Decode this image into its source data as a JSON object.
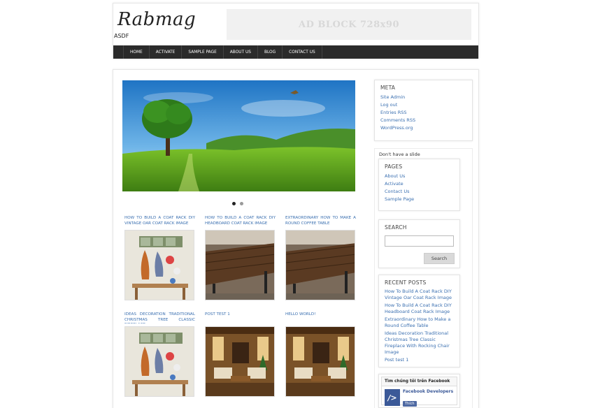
{
  "site": {
    "title": "Rabmag",
    "tagline": "ASDF",
    "ad_text": "AD BLOCK 728x90"
  },
  "nav": {
    "items": [
      "Home",
      "Activate",
      "Sample Page",
      "About Us",
      "Blog",
      "Contact Us"
    ]
  },
  "slider": {
    "dots": 2,
    "active_dot": 1
  },
  "posts": [
    {
      "title": "How to Build a Coat Rack DIY Vintage Oar Coat Rack Image",
      "image": "coat-rack-photo"
    },
    {
      "title": "How to Build a Coat Rack DIY Headboard Coat Rack Image",
      "image": "wooden-table-photo"
    },
    {
      "title": "Extraordinary How to Make a Round Coffee Table",
      "image": "wooden-table-photo"
    },
    {
      "title": "Ideas Decoration Traditional Christmas Tree Classic Fireplace",
      "image": "coat-rack-photo"
    },
    {
      "title": "Post test 1",
      "image": "living-room-photo"
    },
    {
      "title": "Hello world!",
      "image": "living-room-photo"
    }
  ],
  "sidebar": {
    "meta": {
      "title": "Meta",
      "links": [
        "Site Admin",
        "Log out",
        "Entries RSS",
        "Comments RSS",
        "WordPress.org"
      ]
    },
    "no_slide_note": "Don't have a slide",
    "pages": {
      "title": "Pages",
      "links": [
        "About Us",
        "Activate",
        "Contact Us",
        "Sample Page"
      ]
    },
    "search": {
      "title": "Search",
      "button": "Search",
      "placeholder": ""
    },
    "recent_posts": {
      "title": "Recent Posts",
      "links": [
        "How To Build A Coat Rack DIY Vintage Oar Coat Rack Image",
        "How To Build A Coat Rack DIY Headboard Coat Rack Image",
        "Extraordinary How to Make a Round Coffee Table",
        "Ideas Decoration Traditional Christmas Tree Classic Fireplace With Rocking Chair Image",
        "Post test 1"
      ]
    },
    "facebook": {
      "header": "Tìm chúng tôi trên Facebook",
      "page_name": "Facebook Developers",
      "like_label": "Thích"
    }
  },
  "colors": {
    "link": "#3a6fb0",
    "nav_bg": "#2b2b2b",
    "facebook": "#3b5998"
  }
}
